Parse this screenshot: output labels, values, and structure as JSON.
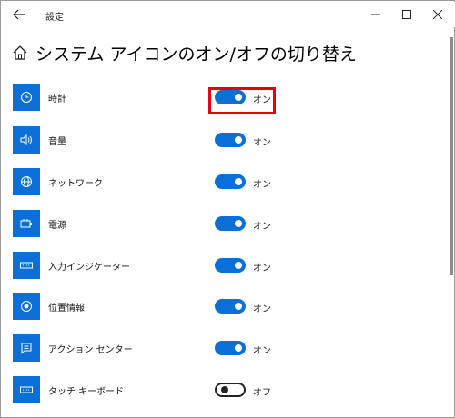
{
  "window": {
    "title": "設定",
    "back_icon": "back-arrow-icon",
    "minimize_icon": "minimize-icon",
    "maximize_icon": "maximize-icon",
    "close_icon": "close-icon"
  },
  "header": {
    "icon": "home-icon",
    "title": "システム アイコンのオン/オフの切り替え"
  },
  "colors": {
    "accent": "#0a6fd6",
    "highlight": "#e60012",
    "toggle_off": "#222222"
  },
  "items": [
    {
      "label": "時計",
      "icon": "clock-icon",
      "on": true,
      "state": "オン"
    },
    {
      "label": "音量",
      "icon": "volume-icon",
      "on": true,
      "state": "オン"
    },
    {
      "label": "ネットワーク",
      "icon": "network-globe-icon",
      "on": true,
      "state": "オン"
    },
    {
      "label": "電源",
      "icon": "power-battery-icon",
      "on": true,
      "state": "オン"
    },
    {
      "label": "入力インジケーター",
      "icon": "keyboard-input-icon",
      "on": true,
      "state": "オン"
    },
    {
      "label": "位置情報",
      "icon": "location-icon",
      "on": true,
      "state": "オン"
    },
    {
      "label": "アクション センター",
      "icon": "action-center-icon",
      "on": true,
      "state": "オン"
    },
    {
      "label": "タッチ キーボード",
      "icon": "touch-keyboard-icon",
      "on": false,
      "state": "オフ"
    }
  ]
}
